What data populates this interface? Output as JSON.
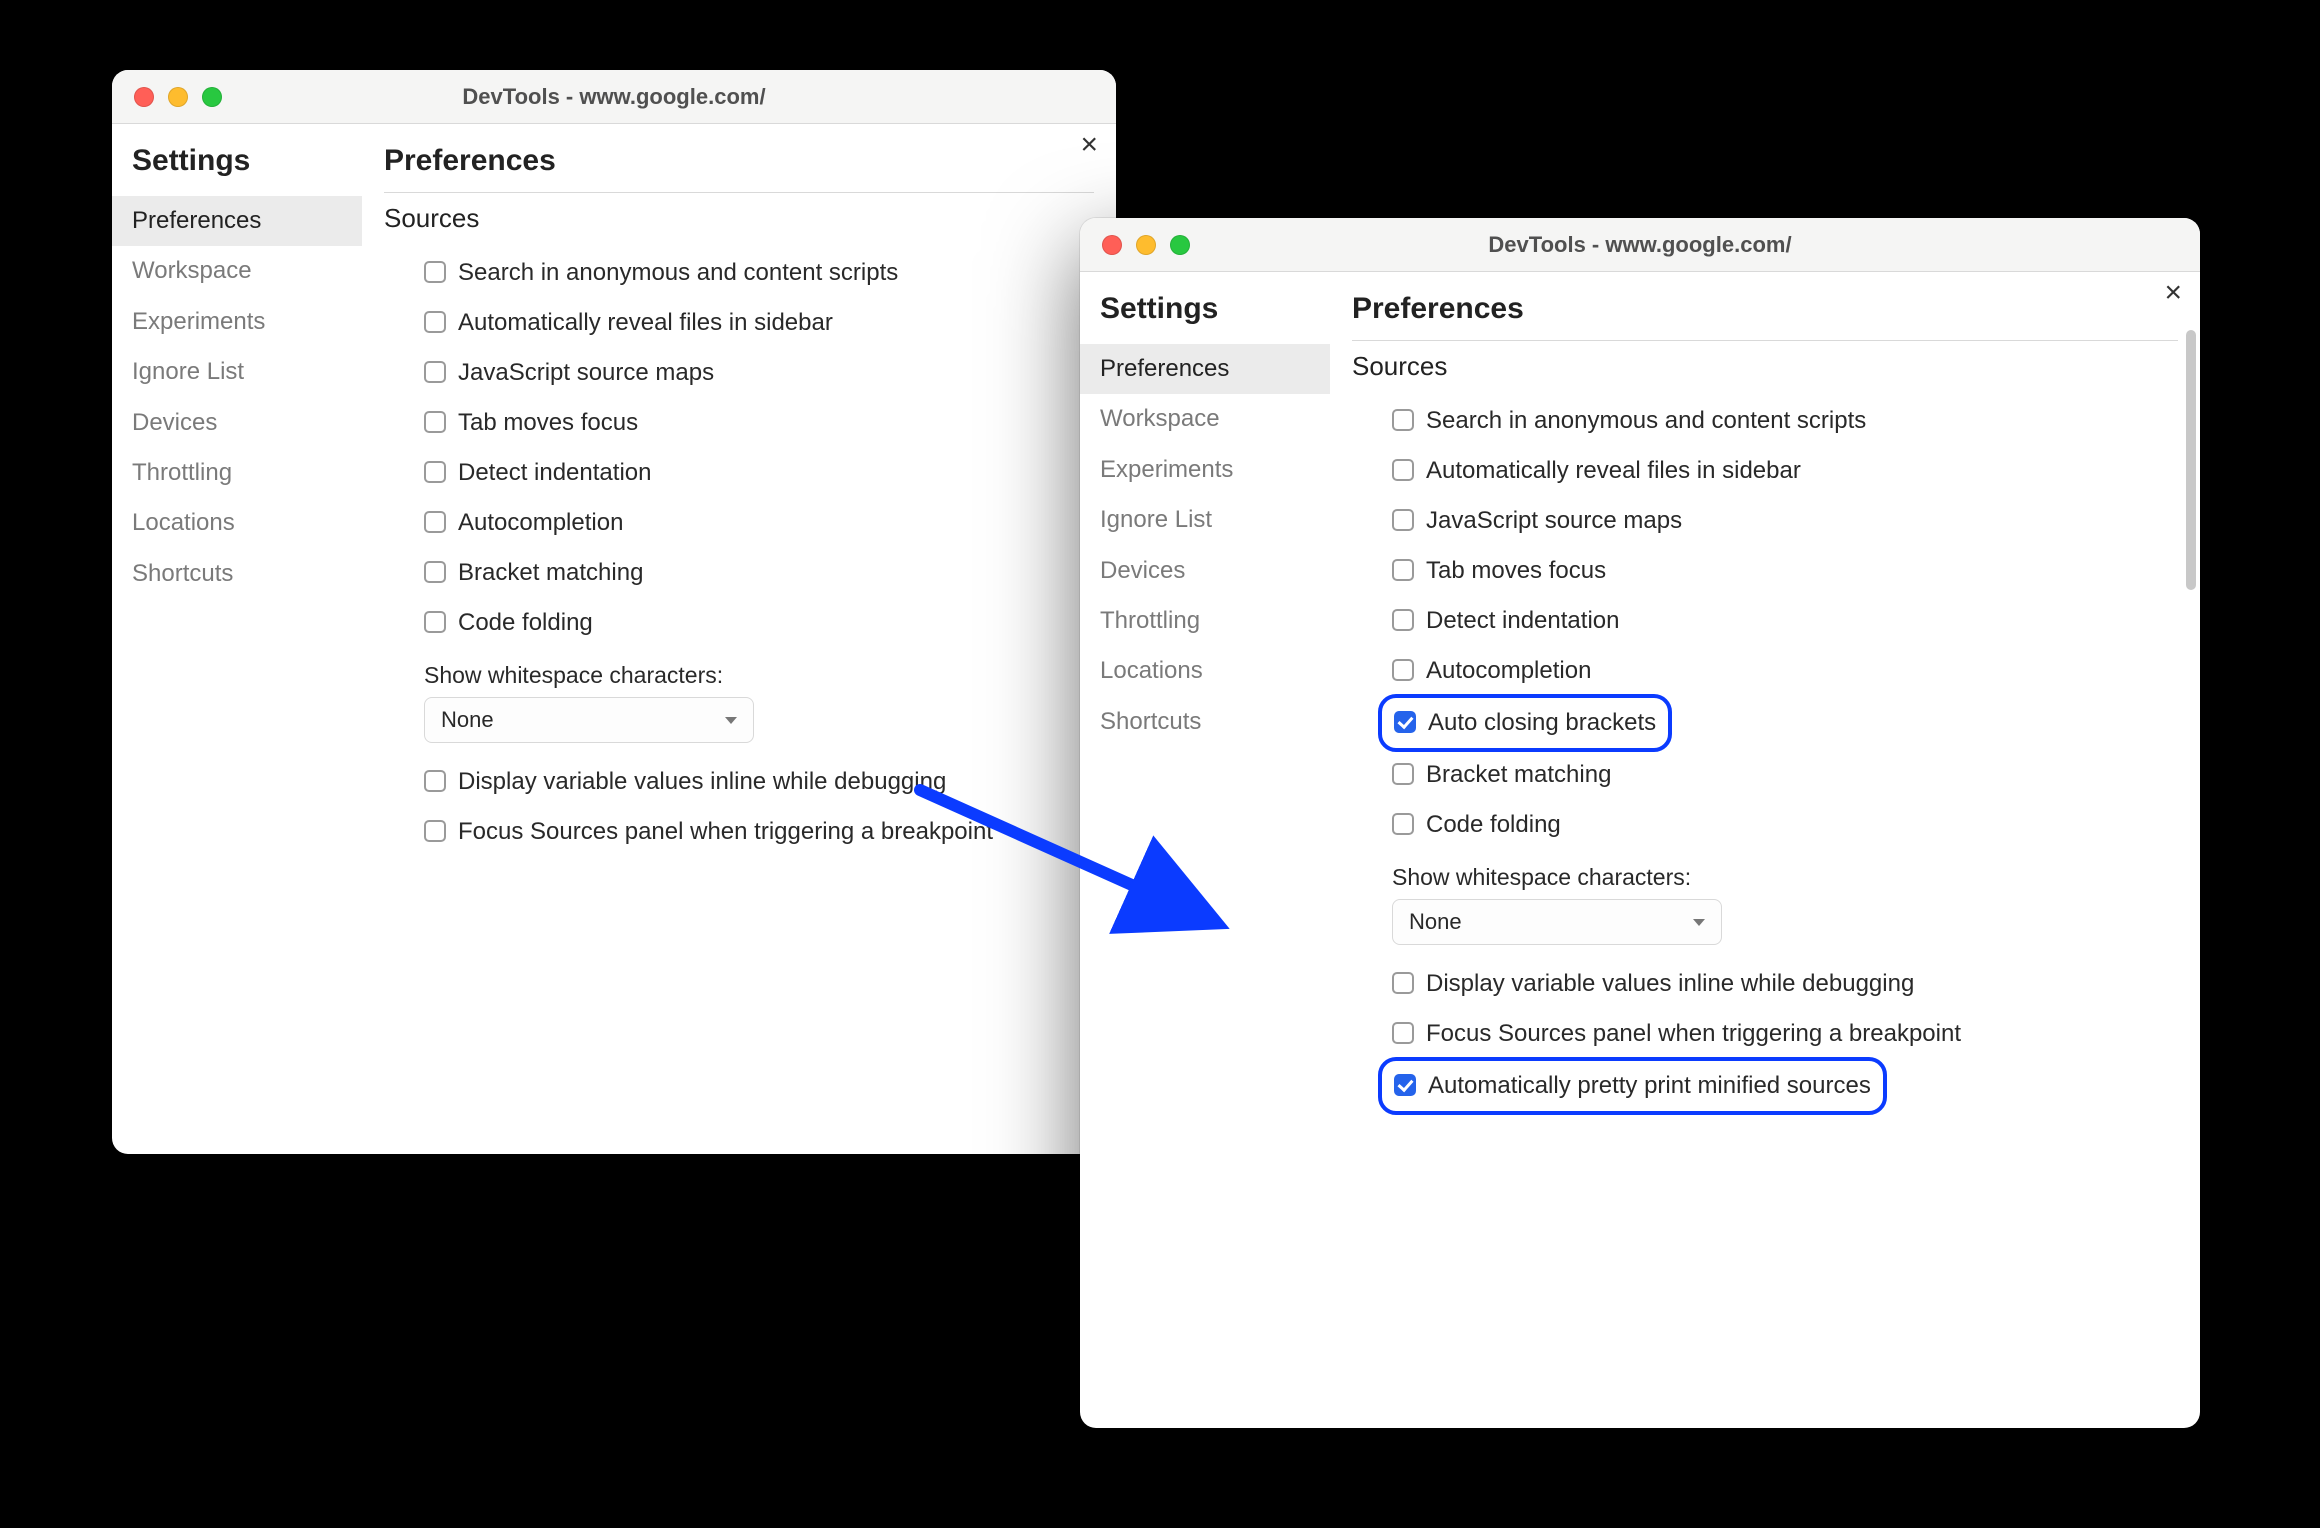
{
  "window_title": "DevTools - www.google.com/",
  "sidebar": {
    "title": "Settings",
    "items": [
      "Preferences",
      "Workspace",
      "Experiments",
      "Ignore List",
      "Devices",
      "Throttling",
      "Locations",
      "Shortcuts"
    ]
  },
  "page": {
    "title": "Preferences",
    "section": "Sources",
    "whitespace_label": "Show whitespace characters:",
    "whitespace_value": "None",
    "close_glyph": "×"
  },
  "left_options": [
    {
      "label": "Search in anonymous and content scripts",
      "checked": false
    },
    {
      "label": "Automatically reveal files in sidebar",
      "checked": false
    },
    {
      "label": "JavaScript source maps",
      "checked": false
    },
    {
      "label": "Tab moves focus",
      "checked": false
    },
    {
      "label": "Detect indentation",
      "checked": false
    },
    {
      "label": "Autocompletion",
      "checked": false
    },
    {
      "label": "Bracket matching",
      "checked": false
    },
    {
      "label": "Code folding",
      "checked": false
    }
  ],
  "left_tail": [
    {
      "label": "Display variable values inline while debugging",
      "checked": false
    },
    {
      "label": "Focus Sources panel when triggering a breakpoint",
      "checked": false
    }
  ],
  "right_options": [
    {
      "label": "Search in anonymous and content scripts",
      "checked": false,
      "highlight": false
    },
    {
      "label": "Automatically reveal files in sidebar",
      "checked": false,
      "highlight": false
    },
    {
      "label": "JavaScript source maps",
      "checked": false,
      "highlight": false
    },
    {
      "label": "Tab moves focus",
      "checked": false,
      "highlight": false
    },
    {
      "label": "Detect indentation",
      "checked": false,
      "highlight": false
    },
    {
      "label": "Autocompletion",
      "checked": false,
      "highlight": false
    },
    {
      "label": "Auto closing brackets",
      "checked": true,
      "highlight": true
    },
    {
      "label": "Bracket matching",
      "checked": false,
      "highlight": false
    },
    {
      "label": "Code folding",
      "checked": false,
      "highlight": false
    }
  ],
  "right_tail": [
    {
      "label": "Display variable values inline while debugging",
      "checked": false,
      "highlight": false
    },
    {
      "label": "Focus Sources panel when triggering a breakpoint",
      "checked": false,
      "highlight": false
    },
    {
      "label": "Automatically pretty print minified sources",
      "checked": true,
      "highlight": true
    }
  ]
}
